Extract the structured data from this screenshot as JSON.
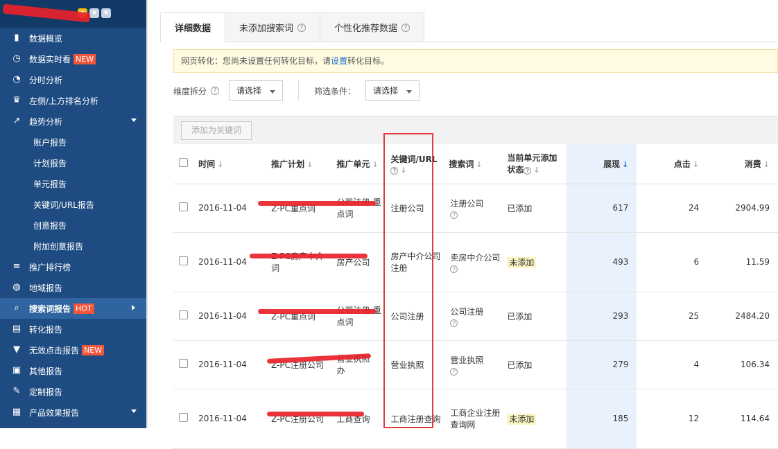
{
  "sidebar": {
    "stars": [
      "★",
      "★",
      "★"
    ],
    "items": [
      {
        "label": "数据概览",
        "icon": "bar-chart-icon",
        "glyph": "▮"
      },
      {
        "label": "数据实时看",
        "icon": "stopwatch-icon",
        "glyph": "◷",
        "badge": "NEW"
      },
      {
        "label": "分时分析",
        "icon": "clock-icon",
        "glyph": "◔"
      },
      {
        "label": "左侧/上方排名分析",
        "icon": "trophy-icon",
        "glyph": "♛"
      },
      {
        "label": "趋势分析",
        "icon": "trend-chart-icon",
        "glyph": "↗"
      }
    ],
    "sub_items": [
      "账户报告",
      "计划报告",
      "单元报告",
      "关键词/URL报告",
      "创意报告",
      "附加创意报告"
    ],
    "items2": [
      {
        "label": "推广排行榜",
        "icon": "list-icon",
        "glyph": "≡"
      },
      {
        "label": "地域报告",
        "icon": "globe-icon",
        "glyph": "◍"
      },
      {
        "label": "搜索词报告",
        "icon": "search-icon",
        "glyph": "⌕",
        "badge": "HOT"
      },
      {
        "label": "转化报告",
        "icon": "clipboard-icon",
        "glyph": "▤"
      },
      {
        "label": "无效点击报告",
        "icon": "filter-icon",
        "glyph": "▼",
        "badge": "NEW"
      },
      {
        "label": "其他报告",
        "icon": "square-icon",
        "glyph": "▣"
      },
      {
        "label": "定制报告",
        "icon": "edit-icon",
        "glyph": "✎"
      },
      {
        "label": "产品效果报告",
        "icon": "calculator-icon",
        "glyph": "▦"
      }
    ]
  },
  "tabs": [
    "详细数据",
    "未添加搜索词",
    "个性化推荐数据"
  ],
  "notice": {
    "prefix": "网页转化：您尚未设置任何转化目标，请",
    "link": "设置",
    "suffix": "转化目标。"
  },
  "filters": {
    "dimension_label": "维度拆分",
    "dimension_value": "请选择",
    "condition_label": "筛选条件：",
    "condition_value": "请选择"
  },
  "toolbar": {
    "add_keyword": "添加为关键词"
  },
  "columns": {
    "time": "时间",
    "plan": "推广计划",
    "unit": "推广单元",
    "keyword": "关键词/URL",
    "search_term": "搜索词",
    "status_line1": "当前单元添加",
    "status_line2": "状态",
    "impressions": "展现",
    "clicks": "点击",
    "cost": "消费"
  },
  "rows": [
    {
      "date": "2016-11-04",
      "plan": "Z-PC重点词",
      "unit_l1": "公司注册-重",
      "unit_l2": "点词",
      "keyword": "注册公司",
      "search_term": "注册公司",
      "status": "已添加",
      "impressions": "617",
      "clicks": "24",
      "cost": "2904.99"
    },
    {
      "date": "2016-11-04",
      "plan_l1": "Z-PC房产中介",
      "plan_l2": "词",
      "unit_l1": "房产公司",
      "keyword": "房产中介公司注册",
      "search_term": "卖房中介公司",
      "status": "未添加",
      "impressions": "493",
      "clicks": "6",
      "cost": "11.59"
    },
    {
      "date": "2016-11-04",
      "plan": "Z-PC重点词",
      "unit_l1": "公司注册-重",
      "unit_l2": "点词",
      "keyword": "公司注册",
      "search_term": "公司注册",
      "status": "已添加",
      "impressions": "293",
      "clicks": "25",
      "cost": "2484.20"
    },
    {
      "date": "2016-11-04",
      "plan": "Z-PC注册公司",
      "unit_l1": "营业执照",
      "unit_l2": "办",
      "keyword": "营业执照",
      "search_term": "营业执照",
      "status": "已添加",
      "impressions": "279",
      "clicks": "4",
      "cost": "106.34"
    },
    {
      "date": "2016-11-04",
      "plan": "Z-PC注册公司",
      "unit_l1": "工商查询",
      "keyword": "工商注册查询",
      "search_term": "工商企业注册查询网",
      "status": "未添加",
      "impressions": "185",
      "clicks": "12",
      "cost": "114.64"
    }
  ],
  "colors": {
    "sidebar": "#1e4c82",
    "accent": "#1a6dcc",
    "annotation": "#e23b3b"
  }
}
